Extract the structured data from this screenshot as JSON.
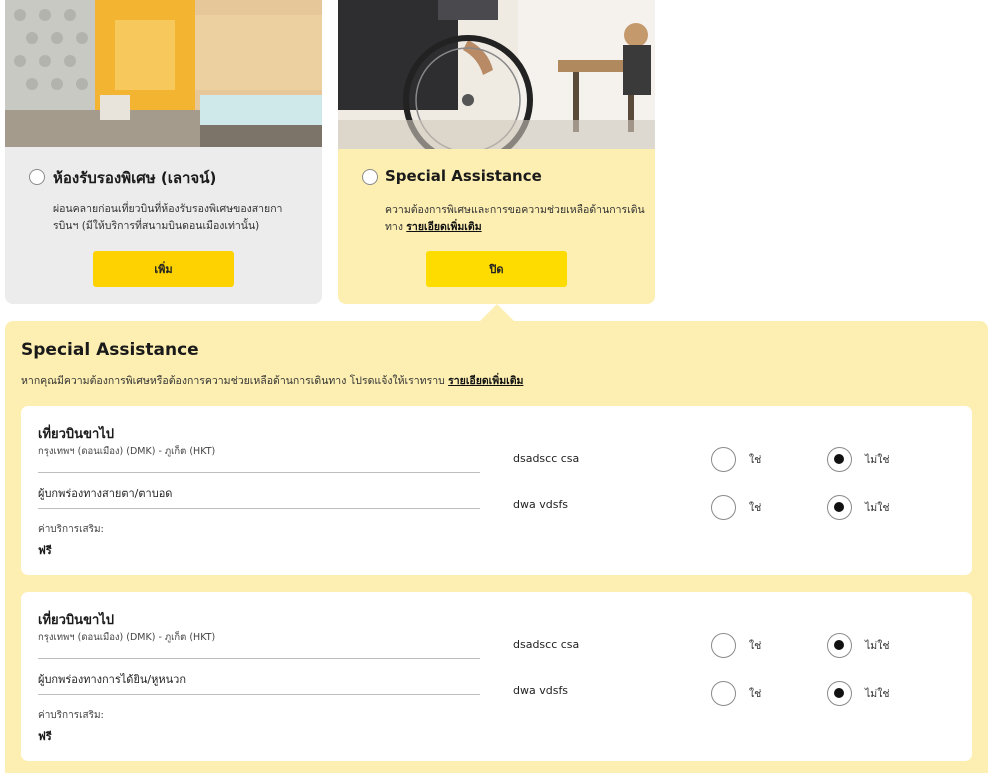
{
  "lounge_card": {
    "title": "ห้องรับรองพิเศษ (เลาจน์)",
    "description": "ผ่อนคลายก่อนเที่ยวบินที่ห้องรับรองพิเศษของสายการบินฯ (มีให้บริการที่สนามบินดอนเมืองเท่านั้น)",
    "button_label": "เพิ่ม"
  },
  "assistance_card": {
    "title": "Special Assistance",
    "description": "ความต้องการพิเศษและการขอความช่วยเหลือด้านการเดินทาง",
    "link": "รายเอียดเพิ่มเติม",
    "button_label": "ปิด"
  },
  "panel": {
    "title": "Special Assistance",
    "description": "หากคุณมีความต้องการพิเศษหรือต้องการความช่วยเหลือด้านการเดินทาง โปรดแจ้งให้เราทราบ",
    "link": "รายเอียดเพิ่มเติม"
  },
  "flights": [
    {
      "title": "เที่ยวบินขาไป",
      "route": "กรุงเทพฯ (ดอนเมือง) (DMK) - ภูเก็ต (HKT)",
      "service": "ผู้บกพร่องทางสายตา/ตาบอด",
      "fee_label": "ค่าบริการเสริม:",
      "fee": "ฟรี",
      "passengers": [
        {
          "name": "dsadscc csa",
          "yes_label": "ใช่",
          "no_label": "ไม่ใช่",
          "selected": "no"
        },
        {
          "name": "dwa vdsfs",
          "yes_label": "ใช่",
          "no_label": "ไม่ใช่",
          "selected": "no"
        }
      ]
    },
    {
      "title": "เที่ยวบินขาไป",
      "route": "กรุงเทพฯ (ดอนเมือง) (DMK) - ภูเก็ต (HKT)",
      "service": "ผู้บกพร่องทางการได้ยิน/หูหนวก",
      "fee_label": "ค่าบริการเสริม:",
      "fee": "ฟรี",
      "passengers": [
        {
          "name": "dsadscc csa",
          "yes_label": "ใช่",
          "no_label": "ไม่ใช่",
          "selected": "no"
        },
        {
          "name": "dwa vdsfs",
          "yes_label": "ใช่",
          "no_label": "ไม่ใช่",
          "selected": "no"
        }
      ]
    }
  ],
  "colors": {
    "brand_yellow": "#ffdc00",
    "panel_bg": "#fdefb2",
    "lounge_bg": "#ececec"
  }
}
